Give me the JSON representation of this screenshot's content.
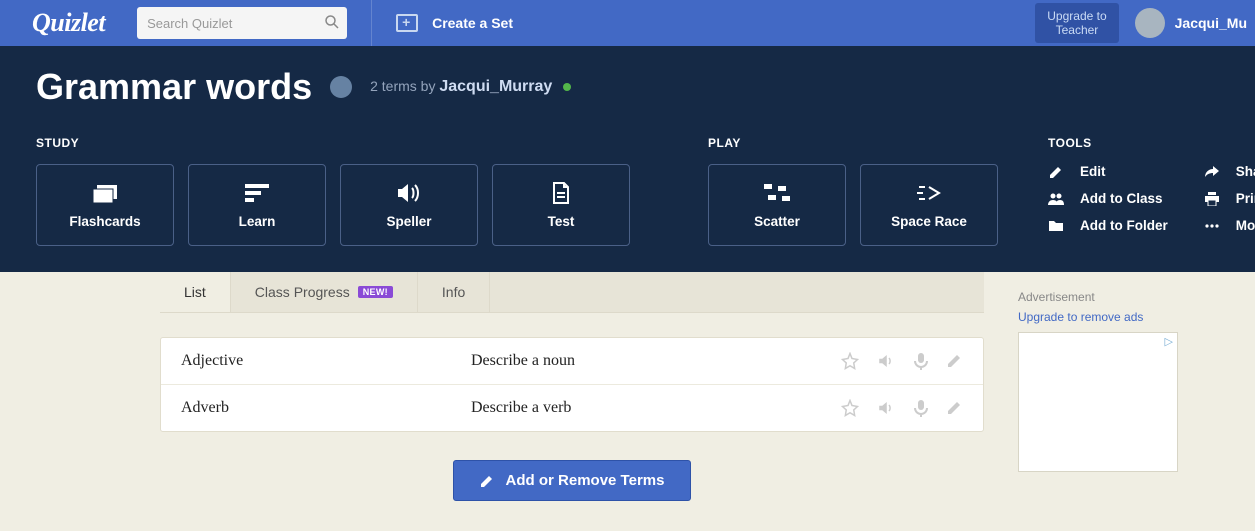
{
  "topnav": {
    "logo": "Quizlet",
    "search_placeholder": "Search Quizlet",
    "create_set": "Create a Set",
    "upgrade_line1": "Upgrade to",
    "upgrade_line2": "Teacher",
    "user_name": "Jacqui_Mu"
  },
  "hero": {
    "title": "Grammar words",
    "meta_terms": "2 terms by ",
    "author": "Jacqui_Murray",
    "study_label": "STUDY",
    "play_label": "PLAY",
    "tools_label": "TOOLS",
    "tiles": {
      "flashcards": "Flashcards",
      "learn": "Learn",
      "speller": "Speller",
      "test": "Test",
      "scatter": "Scatter",
      "spacerace": "Space Race"
    },
    "tools": {
      "edit": "Edit",
      "share": "Share",
      "add_class": "Add to Class",
      "print": "Print",
      "add_folder": "Add to Folder",
      "more": "More"
    }
  },
  "tabs": {
    "list": "List",
    "class_progress": "Class Progress",
    "new_badge": "NEW!",
    "info": "Info"
  },
  "terms": [
    {
      "word": "Adjective",
      "def": "Describe a noun"
    },
    {
      "word": "Adverb",
      "def": "Describe a verb"
    }
  ],
  "add_terms_btn": "Add or Remove Terms",
  "sidebar": {
    "ad_label": "Advertisement",
    "upgrade_link": "Upgrade to remove ads"
  }
}
